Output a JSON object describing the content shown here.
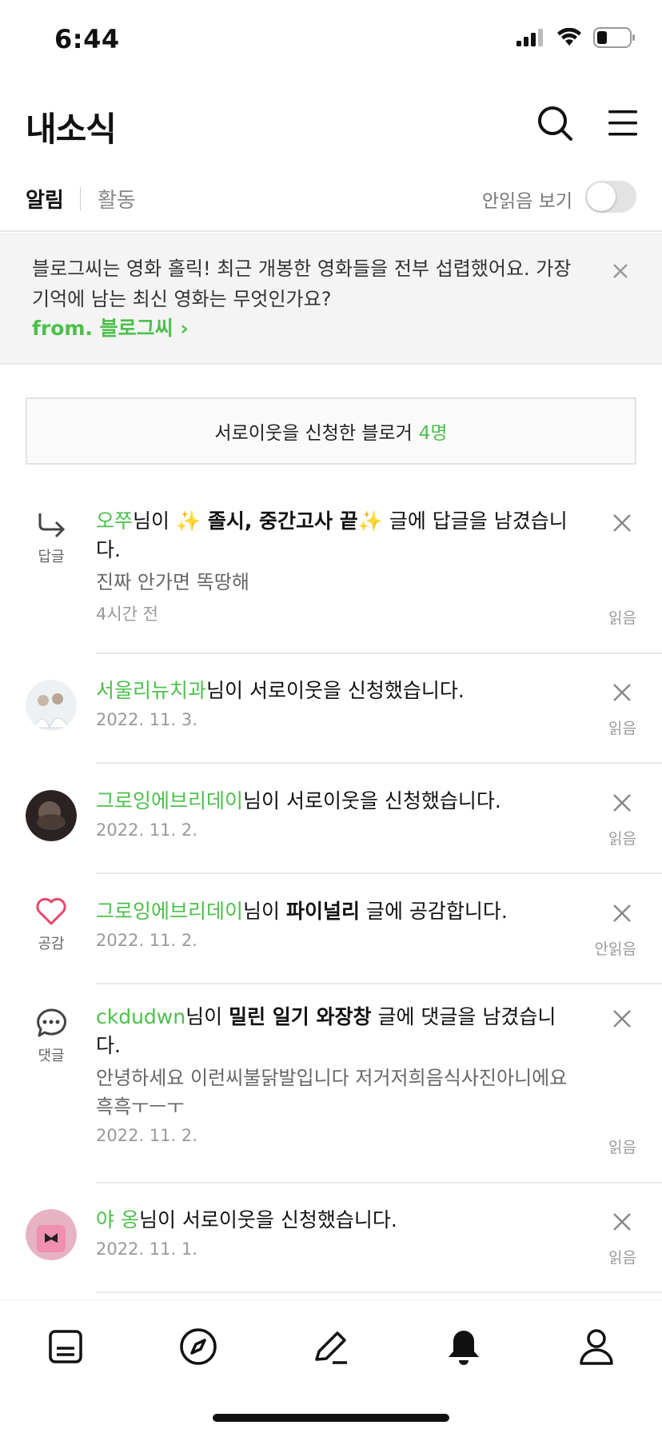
{
  "status_bar": {
    "time": "6:44"
  },
  "header": {
    "title": "내소식"
  },
  "tabs": {
    "active": "알림",
    "inactive": "활동",
    "unread_toggle_label": "안읽음 보기"
  },
  "notice": {
    "text": "블로그씨는 영화 홀릭! 최근 개봉한 영화들을 전부 섭렵했어요. 가장 기억에 남는 최신 영화는 무엇인가요?",
    "from": "from. 블로그씨 ›"
  },
  "neighbor_requests": {
    "label": "서로이웃을 신청한 블로거",
    "count": "4명"
  },
  "notifications": [
    {
      "type_caption": "답글",
      "user": "오쭈",
      "pre": "님이",
      "post_title": "✨ 졸시, 중간고사 끝✨",
      "post_suffix": "글에 답글을 남겼습니다.",
      "excerpt": "진짜 안가면 똑땅해",
      "date": "4시간 전",
      "read_state": "읽음"
    },
    {
      "user": "서울리뉴치과",
      "action": "님이 서로이웃을 신청했습니다.",
      "date": "2022. 11. 3.",
      "read_state": "읽음"
    },
    {
      "user": "그로잉에브리데이",
      "action": "님이 서로이웃을 신청했습니다.",
      "date": "2022. 11. 2.",
      "read_state": "읽음"
    },
    {
      "type_caption": "공감",
      "user": "그로잉에브리데이",
      "pre": "님이",
      "post_title": "파이널리",
      "post_suffix": "글에 공감합니다.",
      "date": "2022. 11. 2.",
      "read_state": "안읽음"
    },
    {
      "type_caption": "댓글",
      "user": "ckdudwn",
      "pre": "님이",
      "post_title": "밀린 일기 와장창",
      "post_suffix": "글에 댓글을 남겼습니다.",
      "excerpt": "안녕하세요 이런씨불닭발입니다 저거저희음식사진아니에요 흑흑ㅜㅡㅜ",
      "date": "2022. 11. 2.",
      "read_state": "읽음"
    },
    {
      "user": "야 옹",
      "action": "님이 서로이웃을 신청했습니다.",
      "date": "2022. 11. 1.",
      "read_state": "읽음"
    }
  ],
  "bottom_nav": {
    "items": [
      "feed-icon",
      "compass-icon",
      "pencil-icon",
      "bell-icon",
      "person-icon"
    ],
    "active": "bell-icon"
  },
  "colors": {
    "accent": "#4cc04b",
    "heart": "#e8476a"
  }
}
